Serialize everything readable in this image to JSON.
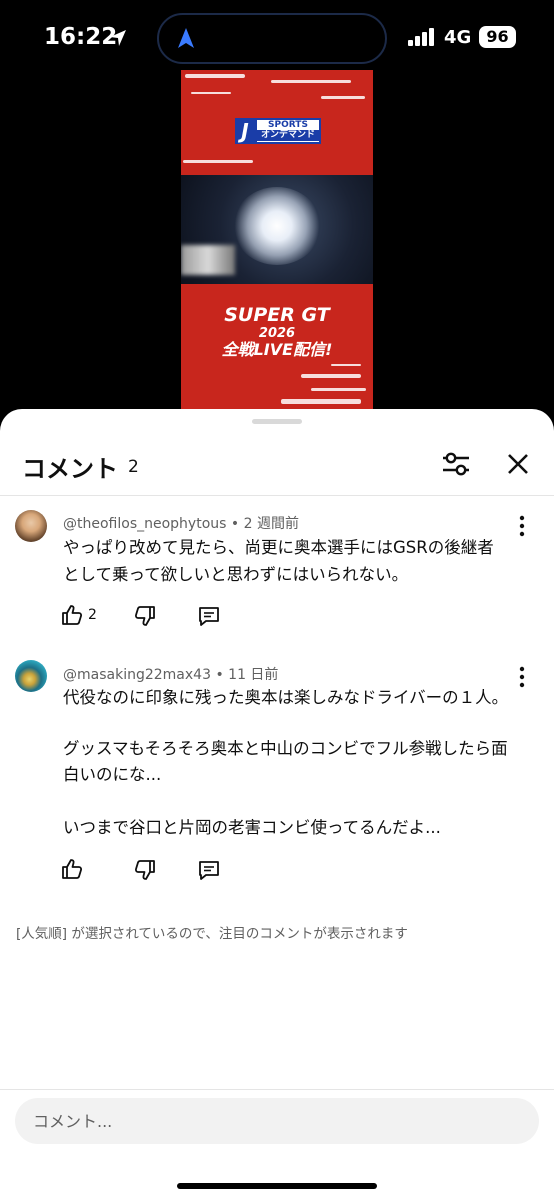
{
  "status_bar": {
    "time": "16:22",
    "network": "4G",
    "battery": "96"
  },
  "video": {
    "logo_brand": "SPORTS",
    "logo_sub": "オンデマンド",
    "promo_line1": "SUPER GT",
    "promo_line2": "2026",
    "promo_line3": "全戦LIVE配信!"
  },
  "comments_panel": {
    "title": "コメント",
    "count": "2",
    "comments": [
      {
        "author": "@theofilos_neophytous",
        "time": "2 週間前",
        "lines": [
          "やっぱり改めて見たら、尚更に奥本選手にはGSRの後継者",
          "として乗って欲しいと思わずにはいられない。"
        ],
        "likes": "2"
      },
      {
        "author": "@masaking22max43",
        "time": "11 日前",
        "lines": [
          "代役なのに印象に残った奥本は楽しみなドライバーの１人。",
          "",
          "グッスマもそろそろ奥本と中山のコンビでフル参戦したら面",
          "白いのにな...",
          "",
          "いつまで谷口と片岡の老害コンビ使ってるんだよ..."
        ],
        "likes": ""
      }
    ],
    "notice": "[人気順] が選択されているので、注目のコメントが表示されます",
    "input_placeholder": "コメント..."
  }
}
